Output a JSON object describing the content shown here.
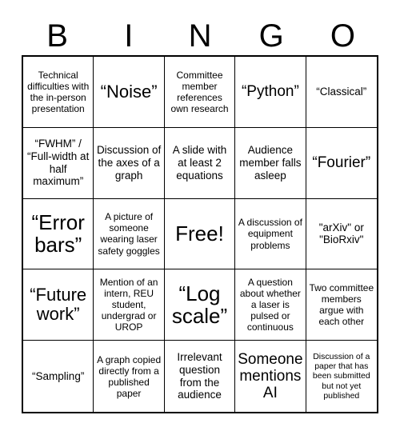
{
  "header": {
    "letters": [
      "B",
      "I",
      "N",
      "G",
      "O"
    ]
  },
  "grid": {
    "rows": 5,
    "columns": 5,
    "free_space": {
      "row": 2,
      "column": 2
    },
    "cells": [
      [
        {
          "text": "Technical difficulties with the in-person presentation",
          "size": "sm"
        },
        {
          "text": "“Noise”",
          "size": "xl"
        },
        {
          "text": "Committee member references own research",
          "size": "sm"
        },
        {
          "text": "“Python”",
          "size": "lg"
        },
        {
          "text": "“Classical”",
          "size": "md"
        }
      ],
      [
        {
          "text": "“FWHM” / “Full-width at half maximum”",
          "size": "md"
        },
        {
          "text": "Discussion of the axes of a graph",
          "size": "md"
        },
        {
          "text": "A slide with at least 2 equations",
          "size": "md"
        },
        {
          "text": "Audience member falls asleep",
          "size": "md"
        },
        {
          "text": "“Fourier”",
          "size": "lg"
        }
      ],
      [
        {
          "text": "“Error bars”",
          "size": "xxl"
        },
        {
          "text": "A picture of someone wearing laser safety goggles",
          "size": "sm"
        },
        {
          "text": "Free!",
          "size": "xxl"
        },
        {
          "text": "A discussion of equipment problems",
          "size": "sm"
        },
        {
          "text": "\"arXiv\" or \"BioRxiv\"",
          "size": "md"
        }
      ],
      [
        {
          "text": "“Future work”",
          "size": "xl"
        },
        {
          "text": "Mention of an intern, REU student, undergrad or UROP",
          "size": "sm"
        },
        {
          "text": "“Log scale”",
          "size": "xxl"
        },
        {
          "text": "A question about whether a laser is pulsed or continuous",
          "size": "sm"
        },
        {
          "text": "Two committee members argue with each other",
          "size": "sm"
        }
      ],
      [
        {
          "text": "“Sampling”",
          "size": "md"
        },
        {
          "text": "A graph copied directly from a published paper",
          "size": "sm"
        },
        {
          "text": "Irrelevant question from the audience",
          "size": "md"
        },
        {
          "text": "Someone mentions AI",
          "size": "lg"
        },
        {
          "text": "Discussion of a paper that has been submitted but not yet published",
          "size": "xs"
        }
      ]
    ]
  },
  "colors": {
    "background": "#ffffff",
    "text": "#000000",
    "border": "#000000"
  }
}
